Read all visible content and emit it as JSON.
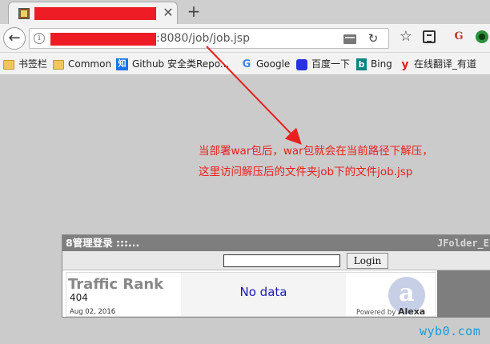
{
  "browser": {
    "tab": {
      "title_redacted": true,
      "close_glyph": "✕"
    },
    "new_tab_glyph": "+",
    "address": {
      "url_visible": ":8080/job/job.jsp",
      "info_glyph": "i"
    },
    "back_glyph": "←",
    "reload_glyph": "↻",
    "star_glyph": "☆",
    "g_glyph": "G",
    "bookmarks": [
      {
        "label": "书签栏",
        "icon": "folder-icon"
      },
      {
        "label": "Common",
        "icon": "folder-icon"
      },
      {
        "label": "Github 安全类Repo...",
        "icon": "zhihu-icon",
        "icon_text": "知"
      },
      {
        "label": "Google",
        "icon": "google-icon",
        "icon_text": "G"
      },
      {
        "label": "百度一下",
        "icon": "baidu-icon"
      },
      {
        "label": "Bing",
        "icon": "bing-icon",
        "icon_text": "b"
      },
      {
        "label": "在线翻译_有道",
        "icon": "youdao-icon",
        "icon_text": "y"
      }
    ]
  },
  "annotation": {
    "line1": "当部署war包后，war包就会在当前路径下解压，",
    "line2": "这里访问解压后的文件夹job下的文件job.jsp",
    "color": "#e8201e"
  },
  "page": {
    "header_title": "8管理登录 :::...",
    "header_right": "JFolder_E",
    "login_button": "Login",
    "login_input_value": "",
    "rank": {
      "title": "Traffic Rank",
      "value": "404",
      "date": "Aug 02, 2016",
      "no_data": "No data",
      "powered_by": "Powered by",
      "alexa": "Alexa",
      "alexa_glyph": "a"
    }
  },
  "watermark": "wyb0.com"
}
